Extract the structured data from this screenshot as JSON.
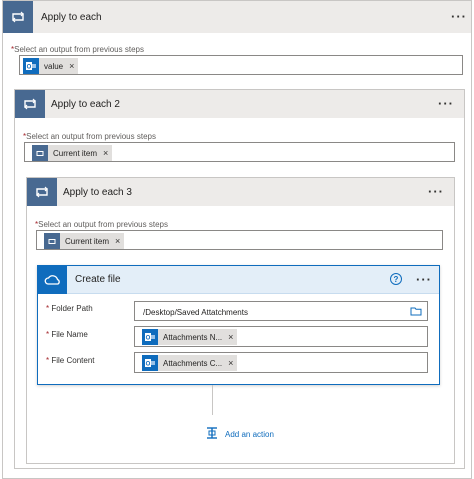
{
  "apply1": {
    "title": "Apply to each",
    "more": "···",
    "field_label": "Select an output from previous steps",
    "required_mark": "*",
    "token": {
      "label": "value",
      "icon": "outlook-icon",
      "remove": "×"
    }
  },
  "apply2": {
    "title": "Apply to each 2",
    "more": "···",
    "field_label": "Select an output from previous steps",
    "required_mark": "*",
    "token": {
      "label": "Current item",
      "icon": "loop-icon",
      "remove": "×"
    }
  },
  "apply3": {
    "title": "Apply to each 3",
    "more": "···",
    "field_label": "Select an output from previous steps",
    "required_mark": "*",
    "token": {
      "label": "Current item",
      "icon": "loop-icon",
      "remove": "×"
    }
  },
  "create_file": {
    "title": "Create file",
    "help": "?",
    "more": "···",
    "fields": {
      "folder_path": {
        "label": "Folder Path",
        "value": "/Desktop/Saved Attatchments"
      },
      "file_name": {
        "label": "File Name",
        "token": "Attachments N...",
        "remove": "×"
      },
      "file_content": {
        "label": "File Content",
        "token": "Attachments C...",
        "remove": "×"
      }
    },
    "required_mark": "*"
  },
  "add_action": {
    "label": "Add an action"
  },
  "colors": {
    "accent": "#0f6cbd",
    "loop": "#486991",
    "header_bg": "#edebe9"
  }
}
